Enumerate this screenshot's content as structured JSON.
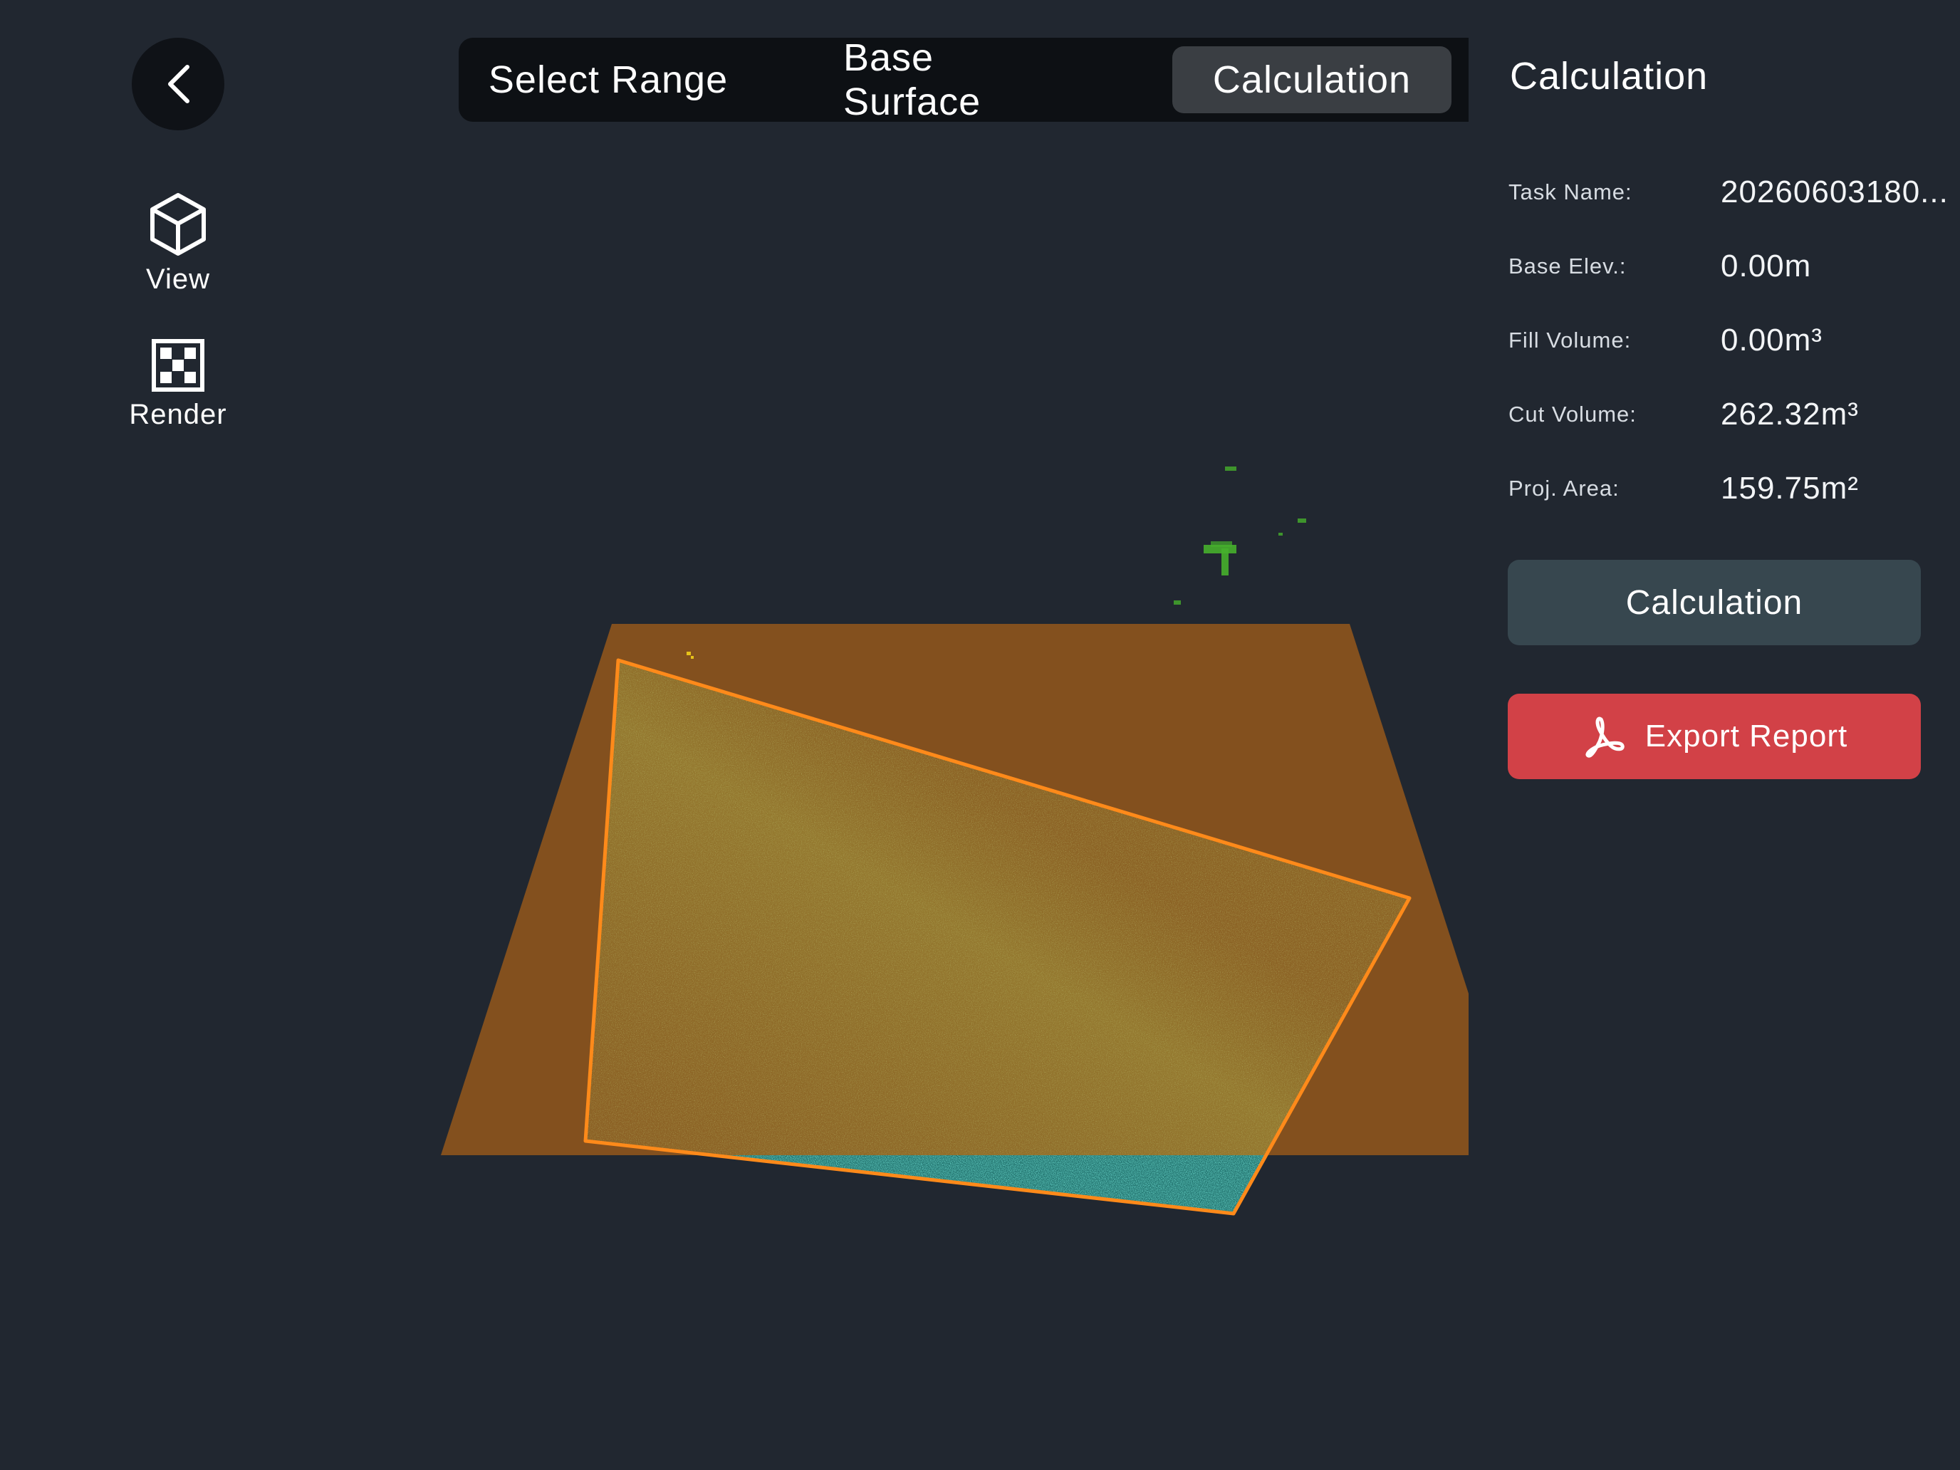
{
  "tabs": {
    "select_range": "Select Range",
    "base_surface": "Base Surface",
    "calculation": "Calculation",
    "active": "calculation"
  },
  "toolbar": {
    "back_icon": "chevron-left-icon",
    "view_label": "View",
    "view_icon": "cube-icon",
    "render_label": "Render",
    "render_icon": "checker-icon"
  },
  "panel": {
    "title": "Calculation",
    "rows": [
      {
        "label": "Task Name:",
        "value": "20260603180..."
      },
      {
        "label": "Base Elev.:",
        "value": "0.00m"
      },
      {
        "label": "Fill Volume:",
        "value": "0.00m³"
      },
      {
        "label": "Cut Volume:",
        "value": "262.32m³"
      },
      {
        "label": "Proj. Area:",
        "value": "159.75m²"
      }
    ],
    "calc_button": "Calculation",
    "export_button": "Export Report",
    "export_icon": "pdf-icon"
  },
  "colors": {
    "background": "#212730",
    "base_plane": "#83501e",
    "boundary": "#ff8a1a",
    "points_green": "#8aa63a",
    "points_teal": "#2aa39a",
    "calc_button": "#37474f",
    "export_button": "#d24147"
  }
}
